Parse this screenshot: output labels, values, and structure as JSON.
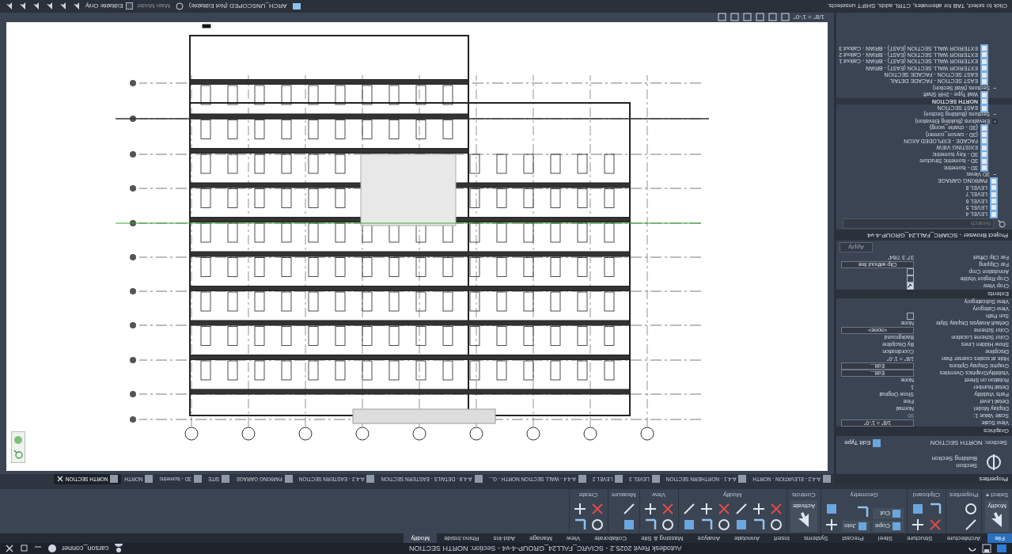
{
  "title_bar": {
    "title": "Autodesk Revit 2025.2 - SCIARC_FALL24_GROUP-4-v4 - Section: NORTH SECTION",
    "user": "carson_conner"
  },
  "ribbon": {
    "tabs": [
      {
        "label": "File",
        "selected": false,
        "kind": "file"
      },
      {
        "label": "Architecture",
        "selected": false
      },
      {
        "label": "Structure",
        "selected": false
      },
      {
        "label": "Steel",
        "selected": false
      },
      {
        "label": "Precast",
        "selected": false
      },
      {
        "label": "Systems",
        "selected": false
      },
      {
        "label": "Insert",
        "selected": false
      },
      {
        "label": "Annotate",
        "selected": false
      },
      {
        "label": "Analyze",
        "selected": false
      },
      {
        "label": "Massing & Site",
        "selected": false
      },
      {
        "label": "Collaborate",
        "selected": false
      },
      {
        "label": "View",
        "selected": false
      },
      {
        "label": "Manage",
        "selected": false
      },
      {
        "label": "Add-Ins",
        "selected": false
      },
      {
        "label": "Rhino.Inside",
        "selected": false
      },
      {
        "label": "Modify",
        "selected": true
      }
    ],
    "panels": [
      {
        "label": "Select ▾",
        "tools": [
          {
            "kind": "large",
            "label": "Modify"
          }
        ]
      },
      {
        "label": "Properties",
        "tools": [
          {
            "kind": "icon"
          },
          {
            "kind": "icon"
          }
        ]
      },
      {
        "label": "Clipboard",
        "tools": [
          {
            "kind": "icon"
          },
          {
            "kind": "icon"
          },
          {
            "kind": "icon"
          },
          {
            "kind": "icon"
          }
        ]
      },
      {
        "label": "Geometry",
        "tools": [
          {
            "kind": "small",
            "label": "Cope"
          },
          {
            "kind": "small",
            "label": "Cut"
          },
          {
            "kind": "small",
            "label": "Join"
          },
          {
            "kind": "icon"
          },
          {
            "kind": "icon"
          },
          {
            "kind": "icon"
          }
        ]
      },
      {
        "label": "Controls",
        "tools": [
          {
            "kind": "large",
            "label": "Activate"
          }
        ]
      },
      {
        "label": "Modify",
        "tools": [
          {
            "kind": "icon"
          },
          {
            "kind": "icon"
          },
          {
            "kind": "icon"
          },
          {
            "kind": "icon"
          },
          {
            "kind": "icon"
          },
          {
            "kind": "icon"
          },
          {
            "kind": "icon"
          },
          {
            "kind": "icon"
          },
          {
            "kind": "icon"
          },
          {
            "kind": "icon"
          },
          {
            "kind": "icon"
          },
          {
            "kind": "icon"
          }
        ]
      },
      {
        "label": "View",
        "tools": [
          {
            "kind": "icon"
          },
          {
            "kind": "icon"
          },
          {
            "kind": "icon"
          },
          {
            "kind": "icon"
          }
        ]
      },
      {
        "label": "Measure",
        "tools": [
          {
            "kind": "icon"
          },
          {
            "kind": "icon"
          }
        ]
      },
      {
        "label": "Create",
        "tools": [
          {
            "kind": "icon"
          },
          {
            "kind": "icon"
          },
          {
            "kind": "icon"
          },
          {
            "kind": "icon"
          }
        ]
      }
    ]
  },
  "properties": {
    "header": "Properties",
    "type_name": "Section",
    "type_sub": "Building Section",
    "instance": "Section: NORTH SECTION",
    "edit_type": "Edit Type",
    "groups": [
      {
        "label": "Graphics",
        "rows": [
          {
            "label": "View Scale",
            "value": "1/8\" = 1'-0\"",
            "kind": "field"
          },
          {
            "label": "Scale Value    1:",
            "value": "96",
            "kind": "readonly"
          },
          {
            "label": "Display Model",
            "value": "Normal",
            "kind": "text"
          },
          {
            "label": "Detail Level",
            "value": "Fine",
            "kind": "text"
          },
          {
            "label": "Parts Visibility",
            "value": "Show Original",
            "kind": "text"
          },
          {
            "label": "Detail Number",
            "value": "1",
            "kind": "text"
          },
          {
            "label": "Rotation on Sheet",
            "value": "None",
            "kind": "text"
          },
          {
            "label": "Visibility/Graphics Overrides",
            "value": "Edit...",
            "kind": "button"
          },
          {
            "label": "Graphic Display Options",
            "value": "Edit...",
            "kind": "button"
          },
          {
            "label": "Hide at scales coarser than",
            "value": "1/8\" = 1'-0\"",
            "kind": "text"
          },
          {
            "label": "Discipline",
            "value": "Coordination",
            "kind": "text"
          },
          {
            "label": "Show Hidden Lines",
            "value": "By Discipline",
            "kind": "text"
          },
          {
            "label": "Color Scheme Location",
            "value": "Background",
            "kind": "text"
          },
          {
            "label": "Color Scheme",
            "value": "<none>",
            "kind": "button"
          },
          {
            "label": "Default Analysis Display Style",
            "value": "None",
            "kind": "text"
          },
          {
            "label": "Sun Path",
            "checked": false,
            "kind": "checkbox"
          },
          {
            "label": "View Category",
            "kind": "empty"
          },
          {
            "label": "View Subcategory",
            "kind": "empty"
          }
        ]
      },
      {
        "label": "Extents",
        "rows": [
          {
            "label": "Crop View",
            "checked": true,
            "kind": "checkbox"
          },
          {
            "label": "Crop Region Visible",
            "checked": false,
            "kind": "checkbox"
          },
          {
            "label": "Annotation Crop",
            "checked": false,
            "kind": "checkbox"
          },
          {
            "label": "Far Clipping",
            "value": "Clip without line",
            "kind": "button"
          },
          {
            "label": "Far Clip Offset",
            "value": "37' 3 7/64\"",
            "kind": "text"
          }
        ]
      }
    ],
    "apply": "Apply"
  },
  "project_browser": {
    "title": "Project Browser - SCIARC_FALL24_GROUP-4-v4",
    "search_placeholder": "Search",
    "items": [
      {
        "label": "LEVEL 4",
        "selected": false
      },
      {
        "label": "LEVEL 5",
        "selected": false
      },
      {
        "label": "LEVEL 6",
        "selected": false
      },
      {
        "label": "LEVEL 7",
        "selected": false
      },
      {
        "label": "LEVEL 8",
        "selected": false
      },
      {
        "label": "PARKING GARAGE",
        "selected": false
      },
      {
        "label": "3D Views",
        "kind": "group",
        "toggle": "−",
        "expanded": true,
        "children": [
          {
            "label": "3D - Isometric",
            "selected": false
          },
          {
            "label": "3D - Isometric Structure",
            "selected": false
          },
          {
            "label": "3D - Key Isometric",
            "selected": false
          },
          {
            "label": "EXISTING VIEW",
            "selected": false
          },
          {
            "label": "FACADE - EXPLODED AXON",
            "selected": false
          },
          {
            "label": "{3D - carson_conner}",
            "selected": false
          },
          {
            "label": "{3D - charlie_wong}",
            "selected": false
          }
        ]
      },
      {
        "label": "Elevations (Building Elevation)",
        "kind": "group",
        "toggle": "+",
        "expanded": false
      },
      {
        "label": "Sections (Building Section)",
        "kind": "group",
        "toggle": "−",
        "expanded": true,
        "children": [
          {
            "label": "EAST SECTION",
            "selected": false
          },
          {
            "label": "NORTH SECTION",
            "selected": true
          },
          {
            "label": "Wall Type - 2HR Shaft",
            "selected": false
          }
        ]
      },
      {
        "label": "Sections (Wall Section)",
        "kind": "group",
        "toggle": "−",
        "expanded": true,
        "children": [
          {
            "label": "EAST SECTION - FACADE DETAIL",
            "selected": false
          },
          {
            "label": "EAST SECTION - FACADE SECTION",
            "selected": false
          },
          {
            "label": "EXTERIOR WALL SECTION (EAST) - BRIAN",
            "selected": false
          },
          {
            "label": "EXTERIOR WALL SECTION (EAST) - BRIAN - Callout 1",
            "selected": false
          },
          {
            "label": "EXTERIOR WALL SECTION (EAST) - BRIAN - Callout 2",
            "selected": false
          },
          {
            "label": "EXTERIOR WALL SECTION (EAST) - BRIAN - Callout 3",
            "selected": false
          }
        ]
      }
    ]
  },
  "view_tabs": [
    {
      "label": "A-4.2 - ELEVATION - NORTH",
      "selected": false
    },
    {
      "label": "A-4.1 - NORTHERN SECTION",
      "selected": false
    },
    {
      "label": "LEVEL 3",
      "selected": false
    },
    {
      "label": "LEVEL 2",
      "selected": false
    },
    {
      "label": "A-4.4 - WALL SECTION NORTH - G...",
      "selected": false
    },
    {
      "label": "A-4.8 - DETAILS - EASTERN SECTION",
      "selected": false
    },
    {
      "label": "A-4.2 - EASTERN SECTION",
      "selected": false
    },
    {
      "label": "PARKING GARAGE",
      "selected": false
    },
    {
      "label": "SITE",
      "selected": false
    },
    {
      "label": "3D - Isometric",
      "selected": false
    },
    {
      "label": "NORTH",
      "selected": false
    },
    {
      "label": "NORTH SECTION",
      "selected": true
    }
  ],
  "view_control": {
    "scale": "1/8\" = 1'-0\""
  },
  "status_bar": {
    "message": "Click to select, TAB for alternates, CTRL adds, SHIFT unselects.",
    "workset": "ARCH_UNSCOPED (Not Editable)",
    "model": "Main Model",
    "editable_only": {
      "label": "Editable Only",
      "checked": false
    }
  }
}
